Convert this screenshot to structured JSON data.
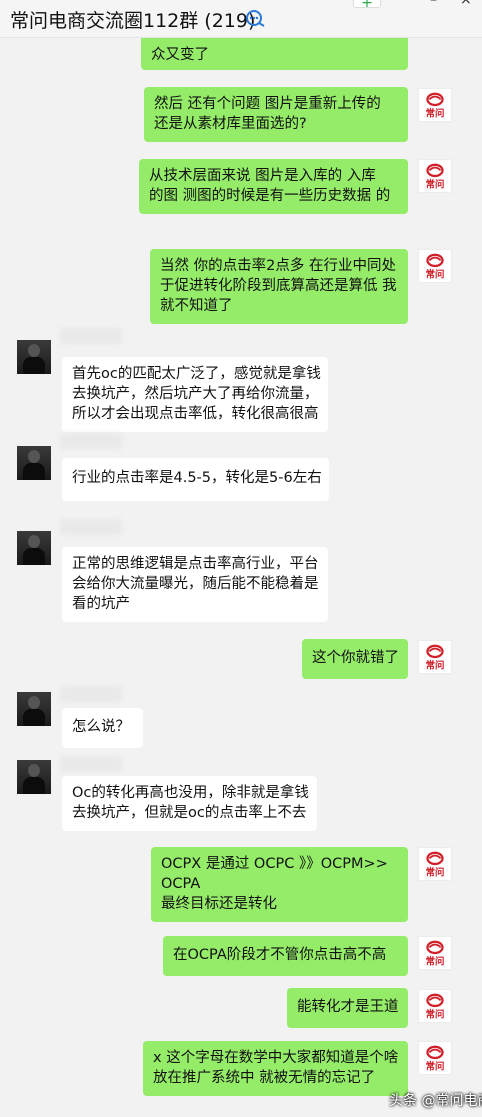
{
  "header": {
    "title": "常问电商交流圈112群 (219)",
    "add_label": "+",
    "minimize_label": "–",
    "close_label": "×"
  },
  "logo": {
    "text": "常问",
    "color": "#d0202a"
  },
  "messages": [
    {
      "side": "right",
      "lines": [
        "众又变了"
      ]
    },
    {
      "side": "right",
      "lines": [
        "然后  还有个问题   图片是重新上传的",
        "还是从素材库里面选的?"
      ]
    },
    {
      "side": "right",
      "lines": [
        "从技术层面来说     图片是入库的  入库",
        "的图  测图的时候是有一些历史数据 的"
      ]
    },
    {
      "side": "right",
      "lines": [
        "当然  你的点击率2点多  在行业中同处",
        "于促进转化阶段到底算高还是算低  我",
        "就不知道了"
      ]
    },
    {
      "side": "left",
      "lines": [
        "首先oc的匹配太广泛了，感觉就是拿钱",
        "去换坑产，然后坑产大了再给你流量，",
        "所以才会出现点击率低，转化很高很高"
      ]
    },
    {
      "side": "left",
      "lines": [
        "行业的点击率是4.5-5，转化是5-6左右"
      ]
    },
    {
      "side": "left",
      "lines": [
        "正常的思维逻辑是点击率高行业，平台",
        "会给你大流量曝光，随后能不能稳着是",
        "看的坑产"
      ]
    },
    {
      "side": "right",
      "lines": [
        "这个你就错了"
      ]
    },
    {
      "side": "left",
      "lines": [
        "怎么说？"
      ]
    },
    {
      "side": "left",
      "lines": [
        "Oc的转化再高也没用，除非就是拿钱",
        "去换坑产，但就是oc的点击率上不去"
      ]
    },
    {
      "side": "right",
      "lines": [
        "OCPX 是通过  OCPC   》》OCPM>>",
        "OCPA",
        "最终目标还是转化"
      ]
    },
    {
      "side": "right",
      "lines": [
        "在OCPA阶段才不管你点击高不高"
      ]
    },
    {
      "side": "right",
      "lines": [
        "能转化才是王道"
      ]
    },
    {
      "side": "right",
      "lines": [
        "x 这个字母在数学中大家都知道是个啥",
        "放在推广系统中 就被无情的忘记了"
      ]
    }
  ],
  "watermark": "头条 @常问电商",
  "colors": {
    "bubble_right": "#95ec69",
    "bubble_left": "#ffffff",
    "background": "#f2f2f2"
  }
}
